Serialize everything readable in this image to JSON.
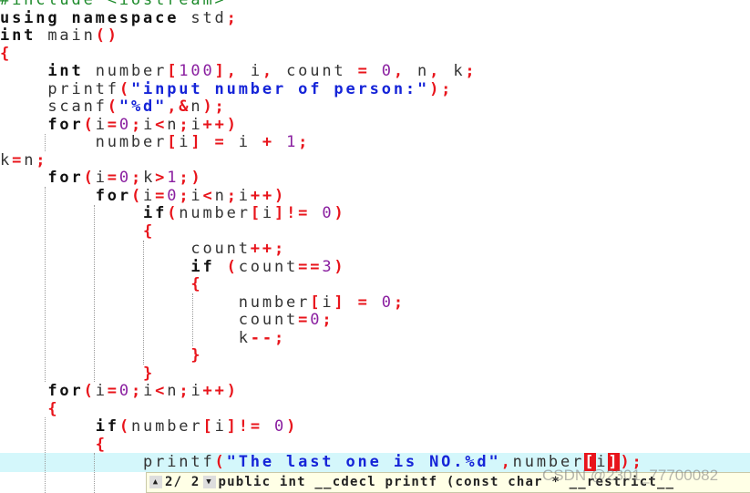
{
  "colors": {
    "keyword": "#111111",
    "identifier": "#333333",
    "operator": "#e8141b",
    "number": "#8a1fa0",
    "string": "#1524d8",
    "preprocessor": "#1c8a2a",
    "current_line": "#d4f7fb"
  },
  "code": {
    "current_line": 26,
    "lines": [
      [
        [
          "pre",
          "#include <iostream>"
        ]
      ],
      [
        [
          "kw",
          "using namespace "
        ],
        [
          "id",
          "std"
        ],
        [
          "op",
          ";"
        ]
      ],
      [
        [
          "kw",
          "int "
        ],
        [
          "id",
          "main"
        ],
        [
          "op",
          "()"
        ]
      ],
      [
        [
          "op",
          "{"
        ]
      ],
      [
        [
          "id",
          "    "
        ],
        [
          "kw",
          "int "
        ],
        [
          "id",
          "number"
        ],
        [
          "op",
          "["
        ],
        [
          "num",
          "100"
        ],
        [
          "op",
          "], "
        ],
        [
          "id",
          "i"
        ],
        [
          "op",
          ", "
        ],
        [
          "id",
          "count "
        ],
        [
          "op",
          "= "
        ],
        [
          "num",
          "0"
        ],
        [
          "op",
          ", "
        ],
        [
          "id",
          "n"
        ],
        [
          "op",
          ", "
        ],
        [
          "id",
          "k"
        ],
        [
          "op",
          ";"
        ]
      ],
      [
        [
          "id",
          "    printf"
        ],
        [
          "op",
          "("
        ],
        [
          "str",
          "\"input number of person:\""
        ],
        [
          "op",
          ");"
        ]
      ],
      [
        [
          "id",
          "    scanf"
        ],
        [
          "op",
          "("
        ],
        [
          "str",
          "\"%d\""
        ],
        [
          "op",
          ",&"
        ],
        [
          "id",
          "n"
        ],
        [
          "op",
          ");"
        ]
      ],
      [
        [
          "id",
          "    "
        ],
        [
          "kw",
          "for"
        ],
        [
          "op",
          "("
        ],
        [
          "id",
          "i"
        ],
        [
          "op",
          "="
        ],
        [
          "num",
          "0"
        ],
        [
          "op",
          ";"
        ],
        [
          "id",
          "i"
        ],
        [
          "op",
          "<"
        ],
        [
          "id",
          "n"
        ],
        [
          "op",
          ";"
        ],
        [
          "id",
          "i"
        ],
        [
          "op",
          "++)"
        ]
      ],
      [
        [
          "id",
          "        number"
        ],
        [
          "op",
          "["
        ],
        [
          "id",
          "i"
        ],
        [
          "op",
          "] = "
        ],
        [
          "id",
          "i "
        ],
        [
          "op",
          "+ "
        ],
        [
          "num",
          "1"
        ],
        [
          "op",
          ";"
        ]
      ],
      [
        [
          "id",
          "k"
        ],
        [
          "op",
          "="
        ],
        [
          "id",
          "n"
        ],
        [
          "op",
          ";"
        ]
      ],
      [
        [
          "id",
          "    "
        ],
        [
          "kw",
          "for"
        ],
        [
          "op",
          "("
        ],
        [
          "id",
          "i"
        ],
        [
          "op",
          "="
        ],
        [
          "num",
          "0"
        ],
        [
          "op",
          ";"
        ],
        [
          "id",
          "k"
        ],
        [
          "op",
          ">"
        ],
        [
          "num",
          "1"
        ],
        [
          "op",
          ";)"
        ]
      ],
      [
        [
          "id",
          "        "
        ],
        [
          "kw",
          "for"
        ],
        [
          "op",
          "("
        ],
        [
          "id",
          "i"
        ],
        [
          "op",
          "="
        ],
        [
          "num",
          "0"
        ],
        [
          "op",
          ";"
        ],
        [
          "id",
          "i"
        ],
        [
          "op",
          "<"
        ],
        [
          "id",
          "n"
        ],
        [
          "op",
          ";"
        ],
        [
          "id",
          "i"
        ],
        [
          "op",
          "++)"
        ]
      ],
      [
        [
          "id",
          "            "
        ],
        [
          "kw",
          "if"
        ],
        [
          "op",
          "("
        ],
        [
          "id",
          "number"
        ],
        [
          "op",
          "["
        ],
        [
          "id",
          "i"
        ],
        [
          "op",
          "]!= "
        ],
        [
          "num",
          "0"
        ],
        [
          "op",
          ")"
        ]
      ],
      [
        [
          "id",
          "            "
        ],
        [
          "op",
          "{"
        ]
      ],
      [
        [
          "id",
          "                count"
        ],
        [
          "op",
          "++;"
        ]
      ],
      [
        [
          "id",
          "                "
        ],
        [
          "kw",
          "if "
        ],
        [
          "op",
          "("
        ],
        [
          "id",
          "count"
        ],
        [
          "op",
          "=="
        ],
        [
          "num",
          "3"
        ],
        [
          "op",
          ")"
        ]
      ],
      [
        [
          "id",
          "                "
        ],
        [
          "op",
          "{"
        ]
      ],
      [
        [
          "id",
          "                    number"
        ],
        [
          "op",
          "["
        ],
        [
          "id",
          "i"
        ],
        [
          "op",
          "] = "
        ],
        [
          "num",
          "0"
        ],
        [
          "op",
          ";"
        ]
      ],
      [
        [
          "id",
          "                    count"
        ],
        [
          "op",
          "="
        ],
        [
          "num",
          "0"
        ],
        [
          "op",
          ";"
        ]
      ],
      [
        [
          "id",
          "                    k"
        ],
        [
          "op",
          "--;"
        ]
      ],
      [
        [
          "id",
          "                "
        ],
        [
          "op",
          "}"
        ]
      ],
      [
        [
          "id",
          "            "
        ],
        [
          "op",
          "}"
        ]
      ],
      [
        [
          "id",
          "    "
        ],
        [
          "kw",
          "for"
        ],
        [
          "op",
          "("
        ],
        [
          "id",
          "i"
        ],
        [
          "op",
          "="
        ],
        [
          "num",
          "0"
        ],
        [
          "op",
          ";"
        ],
        [
          "id",
          "i"
        ],
        [
          "op",
          "<"
        ],
        [
          "id",
          "n"
        ],
        [
          "op",
          ";"
        ],
        [
          "id",
          "i"
        ],
        [
          "op",
          "++)"
        ]
      ],
      [
        [
          "id",
          "    "
        ],
        [
          "op",
          "{"
        ]
      ],
      [
        [
          "id",
          "        "
        ],
        [
          "kw",
          "if"
        ],
        [
          "op",
          "("
        ],
        [
          "id",
          "number"
        ],
        [
          "op",
          "["
        ],
        [
          "id",
          "i"
        ],
        [
          "op",
          "]!= "
        ],
        [
          "num",
          "0"
        ],
        [
          "op",
          ")"
        ]
      ],
      [
        [
          "id",
          "        "
        ],
        [
          "op",
          "{"
        ]
      ],
      [
        [
          "id",
          "            printf"
        ],
        [
          "op",
          "("
        ],
        [
          "str",
          "\"The last one is NO.%d\""
        ],
        [
          "op",
          ","
        ],
        [
          "id",
          "number"
        ],
        [
          "brk",
          "["
        ],
        [
          "id",
          "i"
        ],
        [
          "brk",
          "]"
        ],
        [
          "op",
          ");"
        ]
      ]
    ]
  },
  "tooltip": {
    "up_icon": "triangle-up",
    "down_icon": "triangle-down",
    "overload_index": "2/ 2",
    "signature": "public int __cdecl printf (const char * __restrict__"
  },
  "watermark": "CSDN @2301_77700082"
}
